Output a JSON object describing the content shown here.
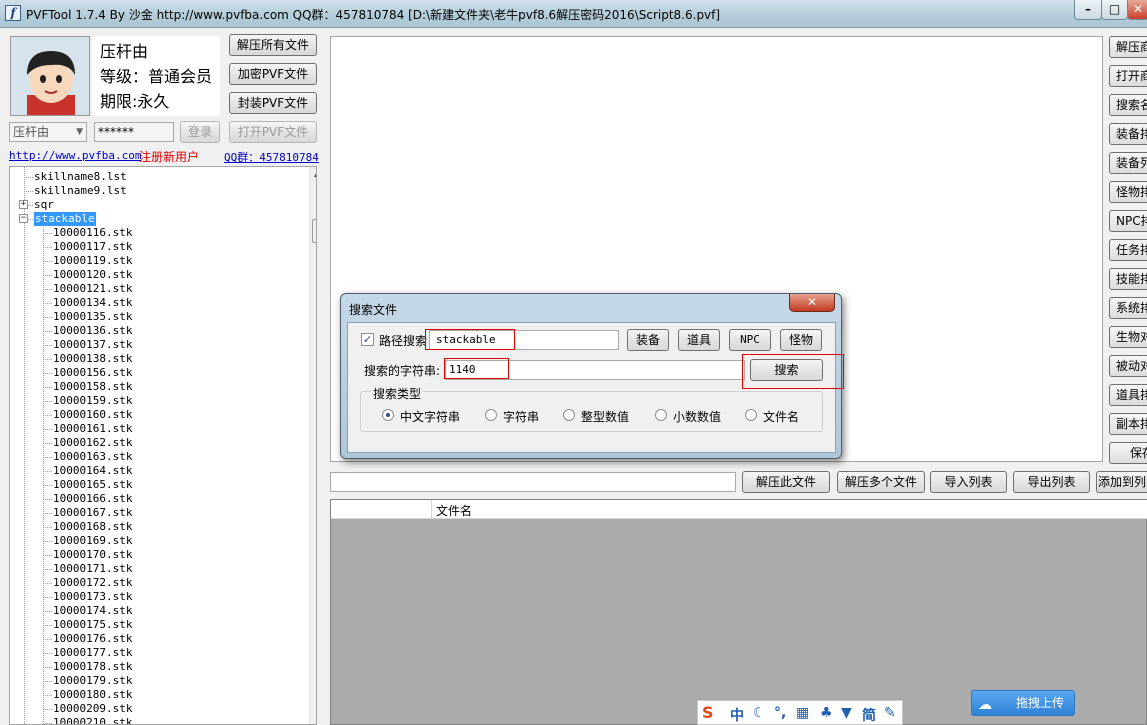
{
  "window": {
    "title": "PVFTool 1.7.4 By 沙金 http://www.pvfba.com QQ群：457810784 [D:\\新建文件夹\\老牛pvf8.6解压密码2016\\Script8.6.pvf]",
    "icon_letter": "f",
    "minimize": "–",
    "maximize": "□",
    "close": "✕"
  },
  "profile": {
    "name": "压杆由",
    "level": "等级：普通会员",
    "expiry": "期限:永久"
  },
  "buttons": {
    "extract_all": "解压所有文件",
    "encrypt_pvf": "加密PVF文件",
    "pack_pvf": "封装PVF文件",
    "login": "登录",
    "open_pvf": "打开PVF文件"
  },
  "login": {
    "username": "压杆由",
    "password": "******"
  },
  "links": {
    "site": "http://www.pvfba.com",
    "register": "注册新用户",
    "qq": "QQ群：457810784"
  },
  "tree": {
    "items": [
      "skillname8.lst",
      "skillname9.lst",
      "sqr",
      "stackable",
      "10000116.stk",
      "10000117.stk",
      "10000119.stk",
      "10000120.stk",
      "10000121.stk",
      "10000134.stk",
      "10000135.stk",
      "10000136.stk",
      "10000137.stk",
      "10000138.stk",
      "10000156.stk",
      "10000158.stk",
      "10000159.stk",
      "10000160.stk",
      "10000161.stk",
      "10000162.stk",
      "10000163.stk",
      "10000164.stk",
      "10000165.stk",
      "10000166.stk",
      "10000167.stk",
      "10000168.stk",
      "10000169.stk",
      "10000170.stk",
      "10000171.stk",
      "10000172.stk",
      "10000173.stk",
      "10000174.stk",
      "10000175.stk",
      "10000176.stk",
      "10000177.stk",
      "10000178.stk",
      "10000179.stk",
      "10000180.stk",
      "10000209.stk",
      "10000210.stk"
    ],
    "expand_plus": "+",
    "expand_minus": "−",
    "scroll_up": "▲"
  },
  "side_buttons": [
    "解压商",
    "打开商",
    "搜索名",
    "装备排",
    "装备列",
    "怪物排",
    "NPC排",
    "任务排",
    "技能排",
    "系统排",
    "生物对",
    "被动对",
    "道具排",
    "副本排",
    "保存"
  ],
  "bottom_toolbar": {
    "extract_this": "解压此文件",
    "extract_multi": "解压多个文件",
    "import_list": "导入列表",
    "export_list": "导出列表",
    "add_to_list": "添加到列"
  },
  "file_list": {
    "column_name": "文件名"
  },
  "dialog": {
    "title": "搜索文件",
    "close": "✕",
    "path_search_label": "路径搜索",
    "path_checked": "✓",
    "path_value": "stackable",
    "btn_equipment": "装备",
    "btn_item": "道具",
    "btn_npc": "NPC",
    "btn_monster": "怪物",
    "search_string_label": "搜索的字符串:",
    "search_value": "1140",
    "search_button": "搜索",
    "search_type_label": "搜索类型",
    "types": [
      "中文字符串",
      "字符串",
      "整型数值",
      "小数数值",
      "文件名"
    ],
    "selected_type": "中文字符串"
  },
  "tray": {
    "ime_symbols": [
      "S",
      "中",
      "☾",
      "°,",
      "▦",
      "♣",
      "▼",
      "简",
      "✎"
    ],
    "upload": "拖拽上传"
  }
}
